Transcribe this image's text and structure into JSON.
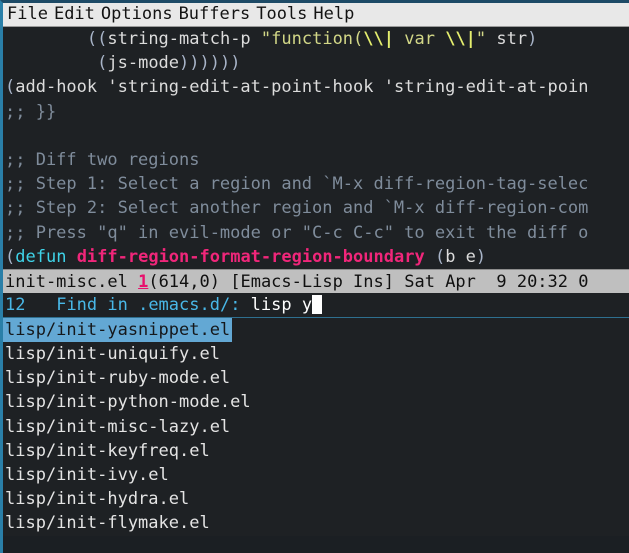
{
  "window": {
    "app": "Emacs",
    "border_color": "#2a7fa8"
  },
  "menubar": {
    "items": [
      {
        "label": "File"
      },
      {
        "label": "Edit"
      },
      {
        "label": "Options"
      },
      {
        "label": "Buffers"
      },
      {
        "label": "Tools"
      },
      {
        "label": "Help"
      }
    ]
  },
  "buffer": {
    "lines": [
      {
        "id": "code-line-1",
        "segments": [
          {
            "text": "        ",
            "cls": "tok-default"
          },
          {
            "text": "((",
            "cls": "tok-paren"
          },
          {
            "text": "string-match-p",
            "cls": "tok-default"
          },
          {
            "text": " ",
            "cls": "tok-default"
          },
          {
            "text": "\"function(",
            "cls": "tok-string"
          },
          {
            "text": "\\\\|",
            "cls": "tok-esc"
          },
          {
            "text": " var ",
            "cls": "tok-string"
          },
          {
            "text": "\\\\|",
            "cls": "tok-esc"
          },
          {
            "text": "\"",
            "cls": "tok-string"
          },
          {
            "text": " str",
            "cls": "tok-default"
          },
          {
            "text": ")",
            "cls": "tok-paren"
          }
        ]
      },
      {
        "id": "code-line-2",
        "segments": [
          {
            "text": "         ",
            "cls": "tok-default"
          },
          {
            "text": "(",
            "cls": "tok-paren"
          },
          {
            "text": "js-mode",
            "cls": "tok-default"
          },
          {
            "text": "))))))",
            "cls": "tok-paren"
          }
        ]
      },
      {
        "id": "code-line-3",
        "segments": [
          {
            "text": "(",
            "cls": "tok-paren"
          },
          {
            "text": "add-hook ",
            "cls": "tok-default"
          },
          {
            "text": "'string-edit-at-point-hook",
            "cls": "tok-default"
          },
          {
            "text": " ",
            "cls": "tok-default"
          },
          {
            "text": "'string-edit-at-poin",
            "cls": "tok-default"
          }
        ]
      },
      {
        "id": "code-line-4",
        "segments": [
          {
            "text": ";; }}",
            "cls": "tok-comment"
          }
        ]
      },
      {
        "id": "code-line-5",
        "segments": [
          {
            "text": "",
            "cls": "tok-default"
          }
        ]
      },
      {
        "id": "code-line-6",
        "segments": [
          {
            "text": ";; Diff two regions",
            "cls": "tok-comment"
          }
        ]
      },
      {
        "id": "code-line-7",
        "segments": [
          {
            "text": ";; Step 1: Select a region and `M-x diff-region-tag-selec",
            "cls": "tok-comment"
          }
        ]
      },
      {
        "id": "code-line-8",
        "segments": [
          {
            "text": ";; Step 2: Select another region and `M-x diff-region-com",
            "cls": "tok-comment"
          }
        ]
      },
      {
        "id": "code-line-9",
        "segments": [
          {
            "text": ";; Press \"q\" in evil-mode or \"C-c C-c\" to exit the diff o",
            "cls": "tok-comment"
          }
        ]
      },
      {
        "id": "code-line-10",
        "segments": [
          {
            "text": "(",
            "cls": "tok-paren"
          },
          {
            "text": "defun",
            "cls": "tok-keyword"
          },
          {
            "text": " ",
            "cls": "tok-default"
          },
          {
            "text": "diff-region-format-region-boundary",
            "cls": "tok-fname"
          },
          {
            "text": " ",
            "cls": "tok-default"
          },
          {
            "text": "(",
            "cls": "tok-paren"
          },
          {
            "text": "b e",
            "cls": "tok-default"
          },
          {
            "text": ")",
            "cls": "tok-paren"
          }
        ]
      }
    ]
  },
  "modeline": {
    "buffer_name": "init-misc.el",
    "modified_indicator": "1",
    "position": "(614,0)",
    "major_mode": "[Emacs-Lisp Ins]",
    "clock": "Sat Apr  9 20:32 0"
  },
  "minibuffer": {
    "candidate_count": "12",
    "gap": "   ",
    "prompt": "Find in .emacs.d/: ",
    "input": "lisp y",
    "cursor": "block"
  },
  "candidates": {
    "selected_index": 0,
    "items": [
      {
        "label": "lisp/init-yasnippet.el"
      },
      {
        "label": "lisp/init-uniquify.el"
      },
      {
        "label": "lisp/init-ruby-mode.el"
      },
      {
        "label": "lisp/init-python-mode.el"
      },
      {
        "label": "lisp/init-misc-lazy.el"
      },
      {
        "label": "lisp/init-keyfreq.el"
      },
      {
        "label": "lisp/init-ivy.el"
      },
      {
        "label": "lisp/init-hydra.el"
      },
      {
        "label": "lisp/init-flymake.el"
      }
    ]
  },
  "colors": {
    "background": "#1e2124",
    "foreground": "#dcdcdc",
    "comment": "#7f8c9b",
    "string": "#d2d787",
    "escape": "#e4ee6e",
    "keyword": "#3fd3e8",
    "function_name": "#f0267a",
    "modeline_bg": "#bfbfbf",
    "selection_bg": "#63a8d4",
    "prompt_fg": "#49b8e8"
  }
}
